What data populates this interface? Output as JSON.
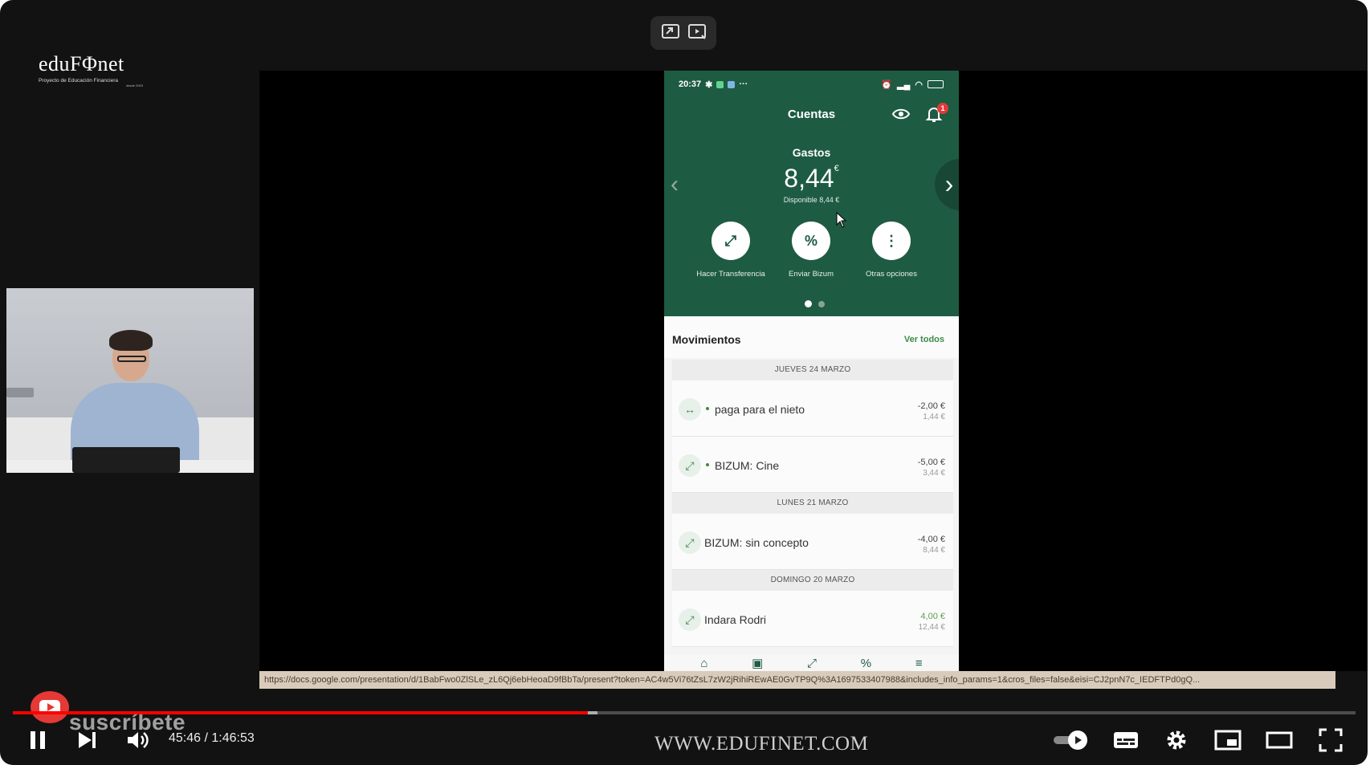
{
  "logo": {
    "brand": "eduFΦnet",
    "tagline": "Proyecto de Educación Financiera",
    "since": "desde 2003"
  },
  "phone": {
    "status": {
      "time": "20:37"
    },
    "header_title": "Cuentas",
    "account": {
      "name": "Gastos",
      "balance": "8,44",
      "currency": "€",
      "available": "Disponible 8,44 €"
    },
    "actions": [
      {
        "label": "Hacer Transferencia",
        "icon": "transfer-icon"
      },
      {
        "label": "Enviar Bizum",
        "icon": "bizum-icon"
      },
      {
        "label": "Otras opciones",
        "icon": "more-options-icon"
      }
    ],
    "notification_badge": "1",
    "movements": {
      "title": "Movimientos",
      "see_all": "Ver todos",
      "dates": [
        "JUEVES 24 MARZO",
        "LUNES 21 MARZO",
        "DOMINGO 20 MARZO"
      ],
      "transactions": [
        {
          "name": "paga para el nieto",
          "amount": "-2,00 €",
          "balance": "1,44 €",
          "icon": "internal-transfer-icon"
        },
        {
          "name": "BIZUM: Cine",
          "amount": "-5,00 €",
          "balance": "3,44 €",
          "icon": "bizum-icon"
        },
        {
          "name": "BIZUM: sin concepto",
          "amount": "-4,00 €",
          "balance": "8,44 €",
          "icon": "bizum-icon"
        },
        {
          "name": "Indara Rodri",
          "amount": "4,00 €",
          "balance": "12,44 €",
          "icon": "bizum-icon"
        }
      ]
    },
    "bottom_nav": [
      "home-icon",
      "wallet-icon",
      "transfer-icon",
      "bizum-icon",
      "menu-icon"
    ]
  },
  "url_bar": "https://docs.google.com/presentation/d/1BabFwo0ZlSLe_zL6Qj6ebHeoaD9fBbTa/present?token=AC4w5Vi76tZsL7zW2jRihiREwAE0GvTP9Q%3A1697533407988&includes_info_params=1&cros_files=false&eisi=CJ2pnN7c_IEDFTPd0gQ...",
  "player": {
    "subscribe": "suscríbete",
    "time": "45:46 / 1:46:53",
    "progress_fraction": 0.428,
    "site_url": "WWW.EDUFINET.COM"
  },
  "colors": {
    "app_green": "#1e5b43",
    "progress_red": "#ff0000",
    "positive_green": "#5c9f4c"
  }
}
